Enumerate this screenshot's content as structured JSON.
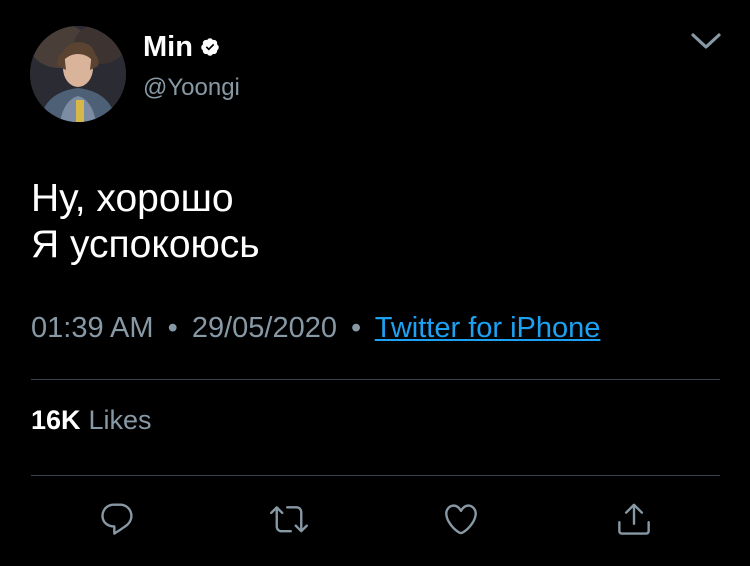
{
  "author": {
    "display_name": "Min",
    "handle": "@Yoongi",
    "verified": true,
    "avatar_icon": "profile-photo"
  },
  "tweet": {
    "lines": [
      "Ну, хорошо",
      "Я успокоюсь"
    ]
  },
  "meta": {
    "time": "01:39 AM",
    "separator": "•",
    "date": "29/05/2020",
    "source": "Twitter for iPhone"
  },
  "stats": {
    "likes_count": "16K",
    "likes_label": "Likes"
  },
  "actions": [
    "reply-icon",
    "retweet-icon",
    "like-icon",
    "share-icon"
  ],
  "colors": {
    "background": "#000000",
    "text": "#ffffff",
    "secondary": "#8899a6",
    "link": "#1da1f2",
    "divider": "#38444d"
  }
}
